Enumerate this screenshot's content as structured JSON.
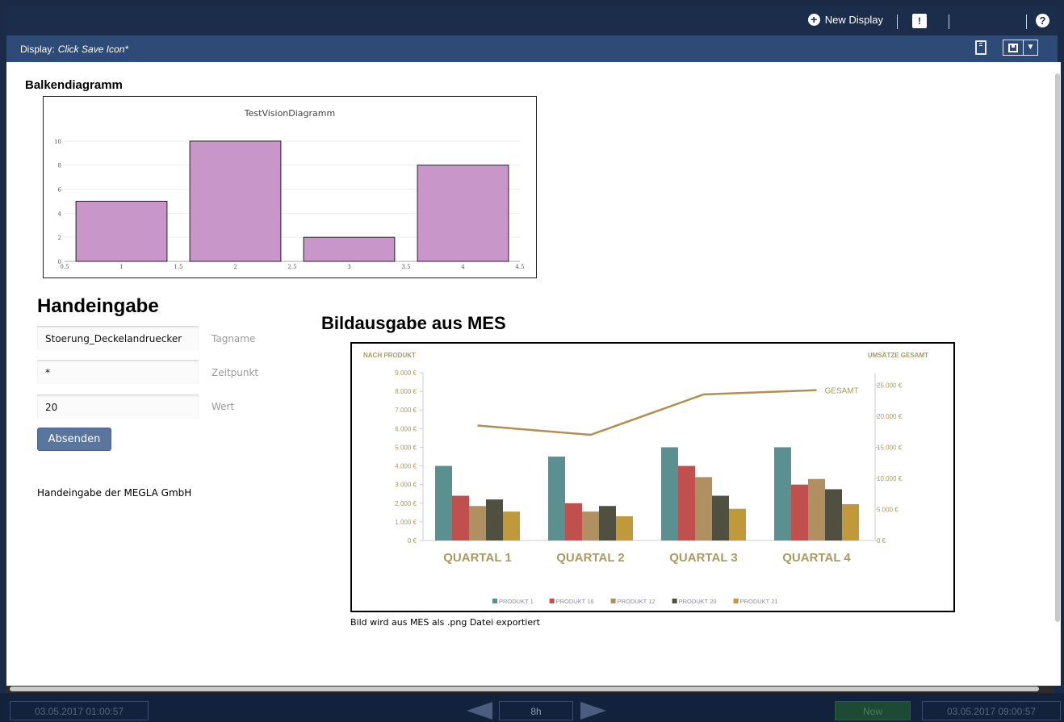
{
  "topbar": {
    "new_display": "New Display",
    "help": "?",
    "msg_icon": "!"
  },
  "display_bar": {
    "label": "Display:",
    "value": "Click Save Icon*"
  },
  "timebar": {
    "start": "03.05.2017 01:00:57",
    "span": "8h",
    "now": "Now",
    "end": "03.05.2017 09:00:57"
  },
  "bar_section": {
    "heading": "Balkendiagramm"
  },
  "hand": {
    "heading": "Handeingabe",
    "tag_value": "Stoerung_Deckelandruecker",
    "tag_label": "Tagname",
    "time_value": "*",
    "time_label": "Zeitpunkt",
    "value_value": "20",
    "value_label": "Wert",
    "submit": "Absenden",
    "note": "Handeingabe der MEGLA GmbH"
  },
  "mes": {
    "heading": "Bildausgabe aus MES",
    "note": "Bild wird aus MES als .png Datei exportiert"
  },
  "chart_data": [
    {
      "type": "bar",
      "title": "TestVisionDiagramm",
      "x": [
        1,
        2,
        3,
        4
      ],
      "values": [
        5,
        10,
        2,
        8
      ],
      "xlim": [
        0.5,
        4.5
      ],
      "ylim": [
        0,
        11
      ],
      "xticks": [
        "0.5",
        "1",
        "1.5",
        "2",
        "2.5",
        "3",
        "3.5",
        "4",
        "4.5"
      ],
      "yticks": [
        "0",
        "2",
        "4",
        "6",
        "8",
        "10"
      ],
      "color": "#c896c8",
      "grid": true
    },
    {
      "type": "bar",
      "left_axis_title": "NACH PRODUKT",
      "right_axis_title": "UMSÄTZE GESAMT",
      "categories": [
        "QUARTAL 1",
        "QUARTAL 2",
        "QUARTAL 3",
        "QUARTAL 4"
      ],
      "left_ticks": [
        "0 €",
        "1.000 €",
        "2.000 €",
        "3.000 €",
        "4.000 €",
        "5.000 €",
        "6.000 €",
        "7.000 €",
        "8.000 €",
        "9.000 €"
      ],
      "right_ticks": [
        "0 €",
        "5.000 €",
        "10.000 €",
        "15.000 €",
        "20.000 €",
        "25.000 €"
      ],
      "ylim_left": [
        0,
        9000
      ],
      "ylim_right": [
        0,
        27000
      ],
      "series": [
        {
          "name": "PRODUKT 1",
          "color": "#5a9090",
          "values": [
            4000,
            4500,
            5000,
            5000
          ]
        },
        {
          "name": "PRODUKT 16",
          "color": "#c0504d",
          "values": [
            2400,
            2000,
            4000,
            3000
          ]
        },
        {
          "name": "PRODUKT 12",
          "color": "#b09060",
          "values": [
            1850,
            1550,
            3400,
            3300
          ]
        },
        {
          "name": "PRODUKT 20",
          "color": "#505040",
          "values": [
            2200,
            1850,
            2400,
            2750
          ]
        },
        {
          "name": "PRODUKT 21",
          "color": "#c09a3a",
          "values": [
            1550,
            1300,
            1700,
            1950
          ]
        }
      ],
      "line": {
        "name": "GESAMT",
        "color": "#b09050",
        "values": [
          18500,
          17000,
          23500,
          24200
        ]
      },
      "label_color": "#a89a60"
    }
  ]
}
